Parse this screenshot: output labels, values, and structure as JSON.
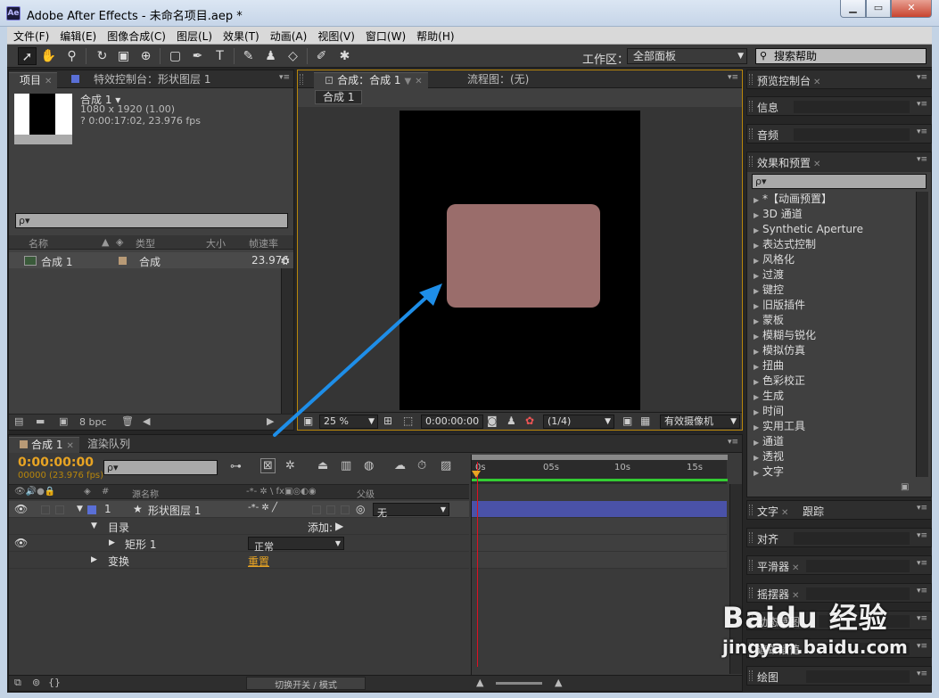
{
  "window": {
    "app_icon_text": "Ae",
    "title": "Adobe After Effects - 未命名项目.aep *",
    "minimize": "▁",
    "maximize": "▭",
    "close": "✕"
  },
  "menu": [
    "文件(F)",
    "编辑(E)",
    "图像合成(C)",
    "图层(L)",
    "效果(T)",
    "动画(A)",
    "视图(V)",
    "窗口(W)",
    "帮助(H)"
  ],
  "toolbar": {
    "workspace_label": "工作区：",
    "workspace_value": "全部面板",
    "help_search": "搜索帮助",
    "tools": [
      "selection-tool",
      "hand-tool",
      "zoom-tool",
      "rotate-tool",
      "camera-tool",
      "pan-behind-tool",
      "rectangle-tool",
      "pen-tool",
      "type-tool",
      "brush-tool",
      "clone-stamp-tool",
      "eraser-tool",
      "roto-brush-tool",
      "puppet-pin-tool"
    ]
  },
  "project_panel": {
    "tab_project": "项目",
    "tab_effect_controls": "特效控制台：形状图层 1",
    "item_name": "合成 1 ▾",
    "item_size": "1080 x 1920 (1.00)",
    "item_duration": "? 0:00:17:02, 23.976 fps",
    "search_placeholder": "ρ▾",
    "col_name": "名称",
    "col_type": "类型",
    "col_size": "大小",
    "col_fps": "帧速率",
    "row_name": "合成 1",
    "row_type": "合成",
    "row_fps": "23.976",
    "bpc": "8 bpc"
  },
  "comp_panel": {
    "tab_comp": "合成：合成 1",
    "tab_flowchart": "流程图：(无)",
    "subtab": "合成 1",
    "zoom": "25 %",
    "timecode": "0:00:00:00",
    "resolution": "(1/4)",
    "camera": "有效摄像机"
  },
  "right_panels": {
    "preview": "预览控制台",
    "info": "信息",
    "audio": "音频",
    "effects_presets": "效果和预置",
    "effects_search": "ρ▾",
    "effects": [
      "*【动画预置】",
      "3D 通道",
      "Synthetic Aperture",
      "表达式控制",
      "风格化",
      "过渡",
      "键控",
      "旧版插件",
      "蒙板",
      "模糊与锐化",
      "模拟仿真",
      "扭曲",
      "色彩校正",
      "生成",
      "时间",
      "实用工具",
      "通道",
      "透视",
      "文字"
    ],
    "text_tab": "文字",
    "tracker_tab": "跟踪",
    "align": "对齐",
    "smoother": "平滑器",
    "wiggler": "摇摆器",
    "motion_sketch": "动态草图",
    "mask_interp": "遮罩插值",
    "paint": "绘图"
  },
  "timeline": {
    "tab_comp": "合成 1",
    "tab_render": "渲染队列",
    "timecode": "0:00:00:00",
    "fps": "00000 (23.976 fps)",
    "search_placeholder": "ρ▾",
    "col_num": "#",
    "col_source": "源名称",
    "col_switch": "-*- ✲ \\ fx▣◎◐◉",
    "col_parent": "父级",
    "ticks": [
      "0s",
      "05s",
      "10s",
      "15s"
    ],
    "layer1_num": "1",
    "layer1_name": "形状图层 1",
    "layer1_parent": "无",
    "contents": "目录",
    "add": "添加:",
    "rect": "矩形 1",
    "blend": "正常",
    "transform": "变换",
    "reset": "重置",
    "footer": "切换开关 / 模式"
  },
  "watermark": {
    "brand": "Baidu 经验",
    "url": "jingyan.baidu.com"
  },
  "colors": {
    "shape_fill": "#9a6d6b",
    "timecode": "#e8a423",
    "arrow": "#1e8ee8",
    "layer_bar": "#4a52a8"
  }
}
